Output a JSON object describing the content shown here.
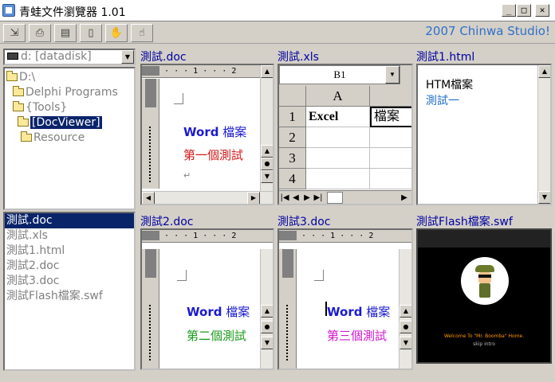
{
  "window": {
    "title": "青蛙文件瀏覽器 1.01",
    "buttons": {
      "minimize": "_",
      "maximize": "□",
      "close": "✕"
    }
  },
  "toolbar": {
    "brand": "2007 Chinwa Studio!",
    "buttons": [
      "open",
      "print",
      "properties",
      "document",
      "tool-a",
      "tool-b"
    ]
  },
  "drive": {
    "value": "d: [datadisk]"
  },
  "tree": [
    {
      "label": "D:\\",
      "level": 0,
      "selected": false
    },
    {
      "label": "Delphi Programs",
      "level": 1,
      "selected": false
    },
    {
      "label": "{Tools}",
      "level": 2,
      "selected": false
    },
    {
      "label": "[DocViewer]",
      "level": 3,
      "selected": true
    },
    {
      "label": "Resource",
      "level": 4,
      "selected": false
    }
  ],
  "files": [
    {
      "label": "測試.doc",
      "selected": true
    },
    {
      "label": "測試.xls",
      "selected": false
    },
    {
      "label": "測試1.html",
      "selected": false
    },
    {
      "label": "測試2.doc",
      "selected": false
    },
    {
      "label": "測試3.doc",
      "selected": false
    },
    {
      "label": "測試Flash檔案.swf",
      "selected": false
    }
  ],
  "panes": {
    "doc1": {
      "title": "測試.doc",
      "ruler": "· · · 1 · · · 2",
      "line1_bold": "Word",
      "line1_rest": " 檔案",
      "line2": "第一個測試",
      "line2_color": "#d01818",
      "para_mark": "↵"
    },
    "xls": {
      "title": "測試.xls",
      "cellref": "B1",
      "col_a": "A",
      "rows": [
        "1",
        "2",
        "3",
        "4"
      ],
      "a1": "Excel",
      "b1": "檔案"
    },
    "html": {
      "title": "測試1.html",
      "line1": "HTM檔案",
      "line2": "測試一"
    },
    "doc2": {
      "title": "測試2.doc",
      "ruler": "· · · 1 · · · 2",
      "line1_bold": "Word",
      "line1_rest": " 檔案",
      "line2": "第二個測試",
      "line2_color": "#1a9a1a"
    },
    "doc3": {
      "title": "測試3.doc",
      "ruler": "· · · 1 · · · 2",
      "line1_bold": "Word",
      "line1_rest": " 檔案",
      "line2": "第三個測試",
      "line2_color": "#d018d0"
    },
    "swf": {
      "title": "測試Flash檔案.swf",
      "caption": "Welcome To \"Mr. Boomba\" Home.",
      "skip": "skip intro"
    }
  }
}
